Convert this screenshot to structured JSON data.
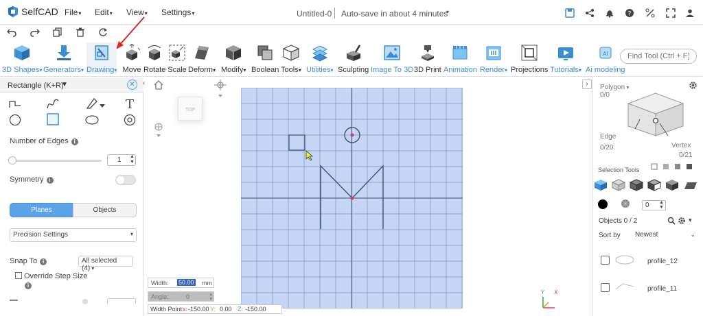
{
  "app": {
    "name": "SelfCAD"
  },
  "menubar": {
    "file": "File",
    "edit": "Edit",
    "view": "View",
    "settings": "Settings"
  },
  "document": {
    "title": "Untitled-0",
    "autosave": "Auto-save in about 4 minutes"
  },
  "toolbar": {
    "shapes3d": "3D Shapes",
    "generators": "Generators",
    "drawing": "Drawing",
    "move": "Move",
    "rotate": "Rotate",
    "scale": "Scale",
    "deform": "Deform",
    "modify": "Modify",
    "boolean": "Boolean",
    "tools": "Tools",
    "utilities": "Utilities",
    "sculpting": "Sculpting",
    "image_to_3d": "Image To 3D",
    "print3d": "3D Print",
    "animation": "Animation",
    "render": "Render",
    "projections": "Projections",
    "tutorials": "Tutorials",
    "ai_modeling": "Ai modeling",
    "find_tool_placeholder": "Find Tool (Ctrl + F)",
    "accent": "#3d8fd4"
  },
  "left_panel": {
    "title": "Rectangle (K+R)",
    "number_of_edges_label": "Number of Edges",
    "number_of_edges_value": "1",
    "symmetry_label": "Symmetry",
    "symmetry_on": false,
    "planes_tab": "Planes",
    "objects_tab": "Objects",
    "precision_settings": "Precision Settings",
    "snap_to_label": "Snap To",
    "snap_to_value": "All selected (4)",
    "override_step_label": "Override Step Size",
    "override_checked": false
  },
  "viewport": {
    "grid_color": "#c5d5f5",
    "width_label": "Width:",
    "width_value": "50.00",
    "width_unit": "mm",
    "angle_label": "Angle:",
    "angle_value": "0",
    "width_point_label": "Width Point:",
    "wp_x_label": "x:",
    "wp_x": "-150.00",
    "wp_y_label": "Y:",
    "wp_y": "0.00",
    "wp_z_label": "Z:",
    "wp_z": "-150.00"
  },
  "right_panel": {
    "polygon_label": "Polygon",
    "polygon_count": "0/0",
    "edge_label": "Edge",
    "edge_count": "0/20",
    "vertex_label": "Vertex",
    "vertex_count": "0/21",
    "selection_tools": "Selection Tools",
    "small_value": "0",
    "objects_count": "Objects 0 / 2",
    "sort_by_label": "Sort by",
    "sort_by_value": "Newest",
    "objects": [
      {
        "name": "profile_12"
      },
      {
        "name": "profile_11"
      }
    ]
  }
}
